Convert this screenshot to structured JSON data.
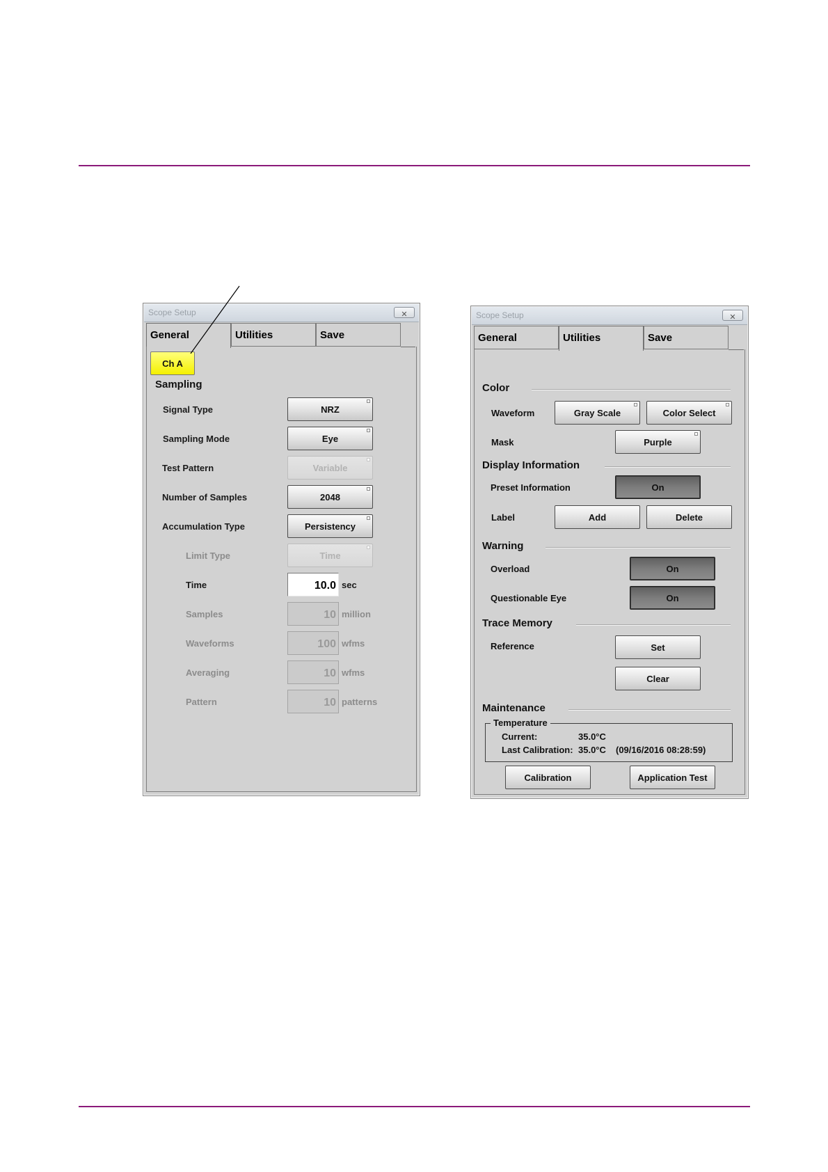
{
  "left_window": {
    "title": "Scope Setup",
    "close_glyph": "✕",
    "tabs": [
      {
        "label": "General",
        "active": true
      },
      {
        "label": "Utilities",
        "active": false
      },
      {
        "label": "Save",
        "active": false
      }
    ],
    "channel_button": "Ch A",
    "section": "Sampling",
    "rows": {
      "signal_type": {
        "label": "Signal Type",
        "value": "NRZ"
      },
      "sampling_mode": {
        "label": "Sampling Mode",
        "value": "Eye"
      },
      "test_pattern": {
        "label": "Test Pattern",
        "value": "Variable"
      },
      "num_samples": {
        "label": "Number of Samples",
        "value": "2048"
      },
      "accumulation_type": {
        "label": "Accumulation Type",
        "value": "Persistency"
      },
      "limit_type": {
        "label": "Limit Type",
        "value": "Time"
      },
      "time": {
        "label": "Time",
        "value": "10.0",
        "unit": "sec"
      },
      "samples": {
        "label": "Samples",
        "value": "10",
        "unit": "million"
      },
      "waveforms": {
        "label": "Waveforms",
        "value": "100",
        "unit": "wfms"
      },
      "averaging": {
        "label": "Averaging",
        "value": "10",
        "unit": "wfms"
      },
      "pattern": {
        "label": "Pattern",
        "value": "10",
        "unit": "patterns"
      }
    }
  },
  "right_window": {
    "title": "Scope Setup",
    "close_glyph": "✕",
    "tabs": [
      {
        "label": "General",
        "active": false
      },
      {
        "label": "Utilities",
        "active": true
      },
      {
        "label": "Save",
        "active": false
      }
    ],
    "color": {
      "section": "Color",
      "waveform_label": "Waveform",
      "gray_scale": "Gray Scale",
      "color_select": "Color Select",
      "mask_label": "Mask",
      "mask_value": "Purple"
    },
    "display_info": {
      "section": "Display Information",
      "preset_label": "Preset Information",
      "preset_value": "On",
      "label_label": "Label",
      "add": "Add",
      "delete": "Delete"
    },
    "warning": {
      "section": "Warning",
      "overload_label": "Overload",
      "overload_value": "On",
      "questionable_label": "Questionable Eye",
      "questionable_value": "On"
    },
    "trace_memory": {
      "section": "Trace Memory",
      "reference_label": "Reference",
      "set": "Set",
      "clear": "Clear"
    },
    "maintenance": {
      "section": "Maintenance",
      "group_title": "Temperature",
      "current_label": "Current:",
      "current_value": "35.0°C",
      "last_cal_label": "Last Calibration:",
      "last_cal_value": "35.0°C",
      "last_cal_time": "(09/16/2016 08:28:59)",
      "calibration": "Calibration",
      "application_test": "Application Test"
    }
  },
  "colors": {
    "rule": "#8b1a7a",
    "panel": "#d2d2d2",
    "channel_button": "#f4f000"
  }
}
